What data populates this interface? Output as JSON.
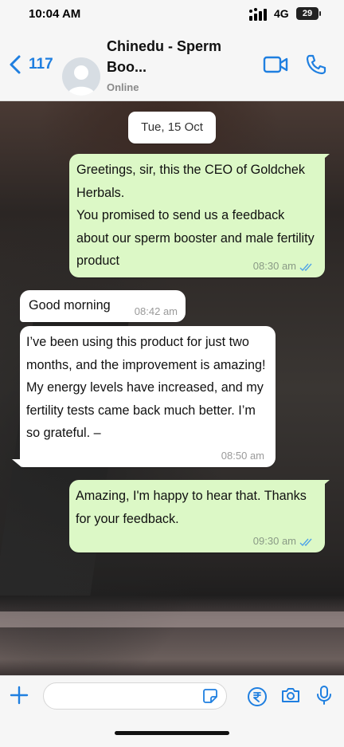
{
  "status": {
    "time": "10:04 AM",
    "network": "4G",
    "battery": "29"
  },
  "header": {
    "back_count": "117",
    "contact_name": "Chinedu - Sperm Boo...",
    "contact_status": "Online"
  },
  "chat": {
    "date_chip": "Tue, 15 Oct",
    "messages": [
      {
        "direction": "outgoing",
        "text": " Greetings, sir, this the CEO of Goldchek Herbals.\nYou promised to send us a feedback about our sperm booster and male fertility product",
        "time": "08:30 am",
        "read": true
      },
      {
        "direction": "incoming",
        "text": "Good morning",
        "time": "08:42 am"
      },
      {
        "direction": "incoming",
        "text": " I’ve been using this product for just two months, and the improvement is amazing! My energy levels have increased, and my fertility tests came back much better. I’m so grateful. –",
        "time": "08:50 am"
      },
      {
        "direction": "outgoing",
        "text": " Amazing, I'm happy to hear that. Thanks for your feedback.",
        "time": "09:30 am",
        "read": true
      }
    ]
  },
  "composer": {
    "placeholder": ""
  },
  "colors": {
    "accent": "#1f7fe0",
    "outgoing_bubble": "#dcf8c6",
    "incoming_bubble": "#ffffff",
    "read_ticks": "#4fa3e8"
  },
  "icons": [
    "back-chevron-icon",
    "video-call-icon",
    "phone-call-icon",
    "plus-icon",
    "sticker-icon",
    "rupee-payment-icon",
    "camera-icon",
    "microphone-icon"
  ]
}
